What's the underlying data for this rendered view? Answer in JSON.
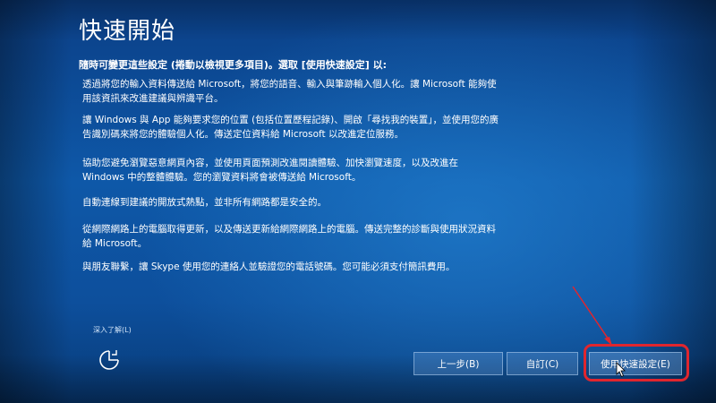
{
  "page": {
    "title": "快速開始",
    "intro": "隨時可變更這些設定 (捲動以檢視更多項目)。選取 [使用快速設定] 以:"
  },
  "settings": [
    {
      "line1": "透過將您的輸入資料傳送給 Microsoft，將您的語音、輸入與筆跡輸入個人化。讓 Microsoft 能夠使",
      "line2": "用該資訊來改進建議與辨識平台。"
    },
    {
      "line1": "讓 Windows 與 App 能夠要求您的位置 (包括位置歷程記錄)、開啟「尋找我的裝置」，並使用您的廣",
      "line2": "告識別碼來將您的體驗個人化。傳送定位資料給 Microsoft 以改進定位服務。"
    },
    {
      "line1": "協助您避免瀏覽惡意網頁內容，並使用頁面預測改進閱讀體驗、加快瀏覽速度，以及改進在",
      "line2": "Windows 中的整體體驗。您的瀏覽資料將會被傳送給 Microsoft。"
    },
    {
      "line1": "自動連線到建議的開放式熱點，並非所有網路都是安全的。",
      "line2": ""
    },
    {
      "line1": "從網際網路上的電腦取得更新，以及傳送更新給網際網路上的電腦。傳送完整的診斷與使用狀況資料",
      "line2": "給 Microsoft。"
    },
    {
      "line1": "與朋友聯繫，讓 Skype 使用您的連絡人並驗證您的電話號碼。您可能必須支付簡訊費用。",
      "line2": ""
    }
  ],
  "footer": {
    "learn_more": "深入了解(L)",
    "back_label": "上一步(B)",
    "custom_label": "自訂(C)",
    "express_label": "使用快速設定(E)"
  },
  "icons": {
    "accessibility": "ease-of-access-icon",
    "cursor": "mouse-cursor-icon"
  },
  "colors": {
    "background": "#0e58a8",
    "highlight": "#e0262e"
  }
}
